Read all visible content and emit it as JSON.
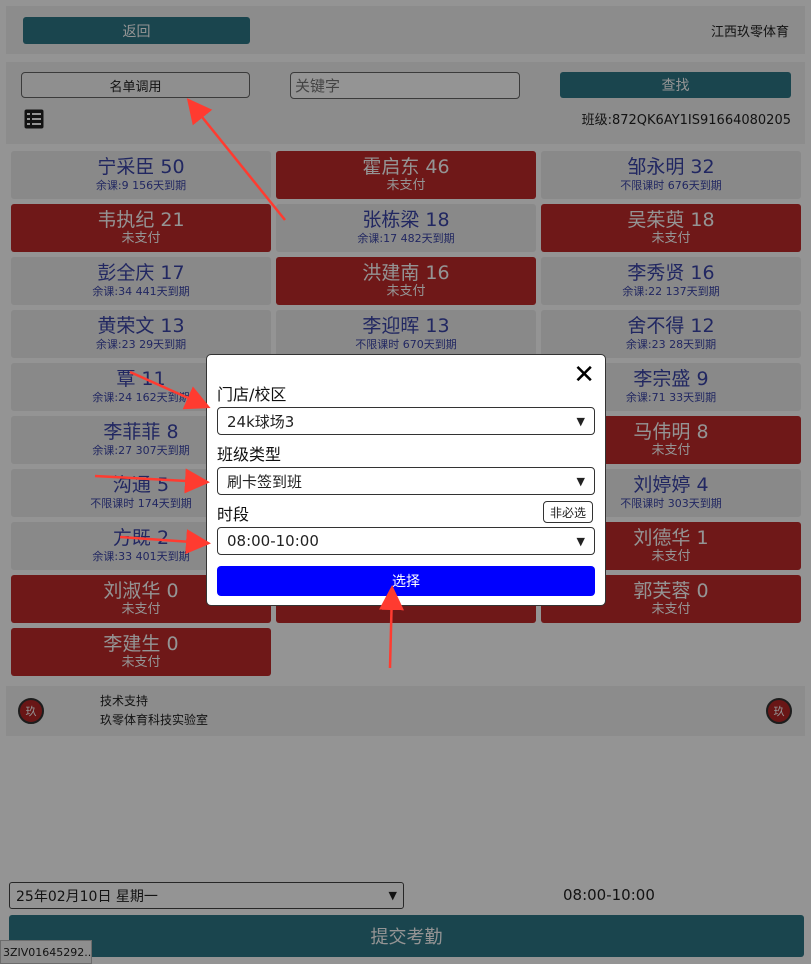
{
  "header": {
    "back_label": "返回",
    "brand": "江西玖零体育"
  },
  "toolbar": {
    "roster_label": "名单调用",
    "search_placeholder": "关键字",
    "search_label": "查找",
    "class_code": "班级:872QK6AY1IS91664080205"
  },
  "students": [
    {
      "name": "宁采臣 50",
      "sub": "余课:9   156天到期",
      "unpaid": false
    },
    {
      "name": "霍启东 46",
      "sub": "未支付",
      "unpaid": true
    },
    {
      "name": "邹永明 32",
      "sub": "不限课时   676天到期",
      "unpaid": false
    },
    {
      "name": "韦执纪 21",
      "sub": "未支付",
      "unpaid": true
    },
    {
      "name": "张栋梁 18",
      "sub": "余课:17   482天到期",
      "unpaid": false
    },
    {
      "name": "吴茱萸 18",
      "sub": "未支付",
      "unpaid": true
    },
    {
      "name": "彭全庆 17",
      "sub": "余课:34   441天到期",
      "unpaid": false
    },
    {
      "name": "洪建南 16",
      "sub": "未支付",
      "unpaid": true
    },
    {
      "name": "李秀贤 16",
      "sub": "余课:22   137天到期",
      "unpaid": false
    },
    {
      "name": "黄荣文 13",
      "sub": "余课:23   29天到期",
      "unpaid": false
    },
    {
      "name": "李迎晖 13",
      "sub": "不限课时   670天到期",
      "unpaid": false
    },
    {
      "name": "舍不得 12",
      "sub": "余课:23   28天到期",
      "unpaid": false
    },
    {
      "name": "覃 11",
      "sub": "余课:24   162天到期",
      "unpaid": false
    },
    {
      "name": "",
      "sub": "",
      "unpaid": false
    },
    {
      "name": "李宗盛 9",
      "sub": "余课:71   33天到期",
      "unpaid": false
    },
    {
      "name": "李菲菲 8",
      "sub": "余课:27   307天到期",
      "unpaid": false
    },
    {
      "name": "",
      "sub": "",
      "unpaid": false
    },
    {
      "name": "马伟明 8",
      "sub": "未支付",
      "unpaid": true
    },
    {
      "name": "沟通 5",
      "sub": "不限课时   174天到期",
      "unpaid": false
    },
    {
      "name": "",
      "sub": "",
      "unpaid": false
    },
    {
      "name": "刘婷婷 4",
      "sub": "不限课时   303天到期",
      "unpaid": false
    },
    {
      "name": "方既 2",
      "sub": "余课:33   401天到期",
      "unpaid": false
    },
    {
      "name": "",
      "sub": "",
      "unpaid": false
    },
    {
      "name": "刘德华 1",
      "sub": "未支付",
      "unpaid": true
    },
    {
      "name": "刘淑华 0",
      "sub": "未支付",
      "unpaid": true
    },
    {
      "name": "",
      "sub": "未支付",
      "unpaid": true
    },
    {
      "name": "郭芙蓉 0",
      "sub": "未支付",
      "unpaid": true
    },
    {
      "name": "李建生 0",
      "sub": "未支付",
      "unpaid": true
    }
  ],
  "footer": {
    "badge_text": "玖",
    "support_line1": "技术支持",
    "support_line2": "玖零体育科技实验室"
  },
  "bottom": {
    "date_value": "25年02月10日 星期一",
    "time_value": "08:00-10:00",
    "submit_label": "提交考勤",
    "url_chip": "3ZIV01645292..."
  },
  "modal": {
    "close_glyph": "✕",
    "store_label": "门店/校区",
    "store_value": "24k球场3",
    "class_type_label": "班级类型",
    "class_type_value": "刷卡签到班",
    "period_label": "时段",
    "optional_label": "非必选",
    "period_value": "08:00-10:00",
    "choose_label": "选择"
  },
  "colors": {
    "teal": "#2e7787",
    "unpaid_red": "#c02a2a",
    "choose_blue": "#0000ff",
    "annotation_arrow": "#ff3b30"
  },
  "icons": [
    "list-icon",
    "close-icon",
    "chevron-down-icon",
    "school-badge-icon"
  ]
}
